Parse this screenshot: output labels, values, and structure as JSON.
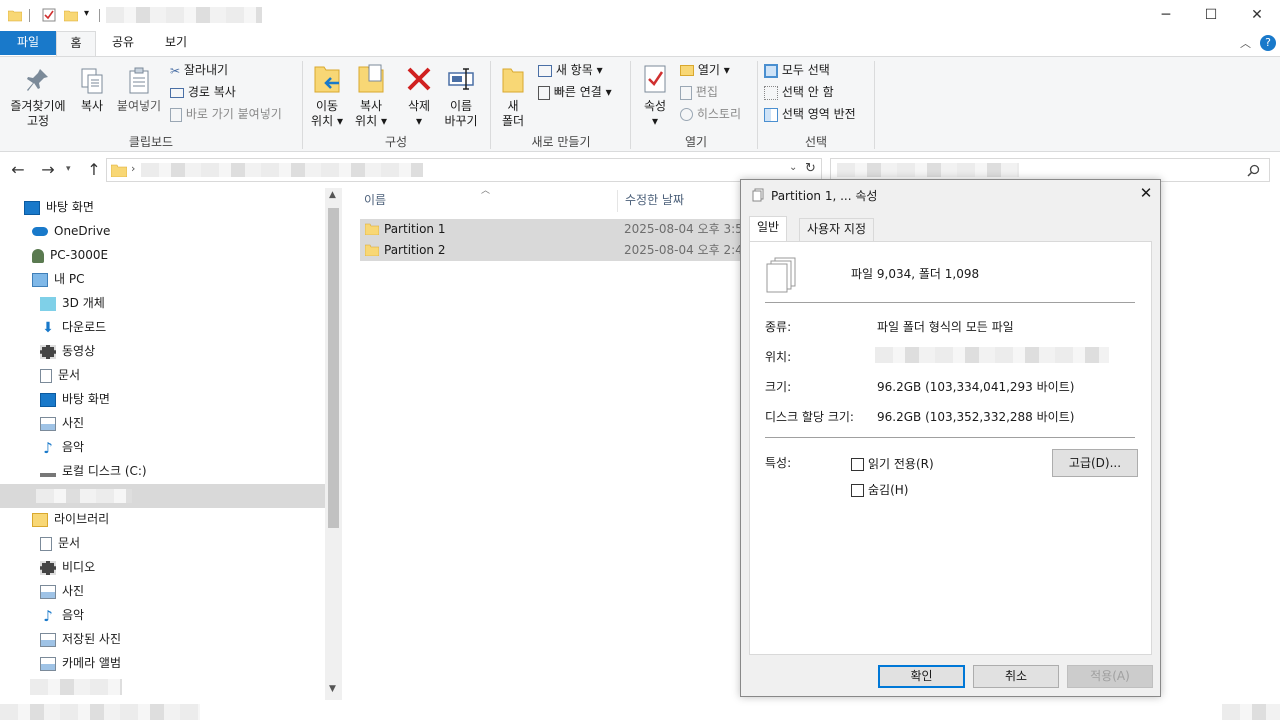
{
  "titlebar": {
    "minimize_label": "─",
    "maximize_label": "☐",
    "close_label": "✕",
    "customize_label": "▾"
  },
  "tabs": [
    {
      "label": "파일"
    },
    {
      "label": "홈"
    },
    {
      "label": "공유"
    },
    {
      "label": "보기"
    }
  ],
  "ribbon": {
    "clipboard": {
      "pin_label_1": "즐겨찾기에",
      "pin_label_2": "고정",
      "copy_label": "복사",
      "paste_label": "붙여넣기",
      "cut_label": "잘라내기",
      "copy_path_label": "경로 복사",
      "paste_shortcut_label": "바로 가기 붙여넣기",
      "group_label": "클립보드"
    },
    "organize": {
      "move_label_1": "이동",
      "move_label_2": "위치",
      "copyto_label_1": "복사",
      "copyto_label_2": "위치",
      "delete_label": "삭제",
      "rename_label_1": "이름",
      "rename_label_2": "바꾸기",
      "group_label": "구성"
    },
    "new": {
      "newfolder_label_1": "새",
      "newfolder_label_2": "폴더",
      "newitem_label": "새 항목",
      "easyaccess_label": "빠른 연결",
      "group_label": "새로 만들기"
    },
    "open": {
      "properties_label": "속성",
      "open_label": "열기",
      "edit_label": "편집",
      "history_label": "히스토리",
      "group_label": "열기"
    },
    "select": {
      "selectall_label": "모두 선택",
      "selectnone_label": "선택 안 함",
      "invert_label": "선택 영역 반전",
      "group_label": "선택"
    }
  },
  "nav": {
    "items": [
      {
        "label": "바탕 화면",
        "icon": "desktop-icon"
      },
      {
        "label": "OneDrive",
        "icon": "cloud-icon"
      },
      {
        "label": "PC-3000E",
        "icon": "user-icon"
      },
      {
        "label": "내 PC",
        "icon": "computer-icon"
      },
      {
        "label": "3D 개체",
        "icon": "cube-icon"
      },
      {
        "label": "다운로드",
        "icon": "download-icon"
      },
      {
        "label": "동영상",
        "icon": "film-icon"
      },
      {
        "label": "문서",
        "icon": "document-icon"
      },
      {
        "label": "바탕 화면",
        "icon": "desktop-icon"
      },
      {
        "label": "사진",
        "icon": "picture-icon"
      },
      {
        "label": "음악",
        "icon": "music-icon"
      },
      {
        "label": "로컬 디스크 (C:)",
        "icon": "drive-icon"
      },
      {
        "label": "",
        "icon": "blurred"
      },
      {
        "label": "라이브러리",
        "icon": "library-icon"
      },
      {
        "label": "문서",
        "icon": "document-icon"
      },
      {
        "label": "비디오",
        "icon": "film-icon"
      },
      {
        "label": "사진",
        "icon": "picture-icon"
      },
      {
        "label": "음악",
        "icon": "music-icon"
      },
      {
        "label": "저장된 사진",
        "icon": "picture-icon"
      },
      {
        "label": "카메라 앨범",
        "icon": "picture-icon"
      }
    ]
  },
  "filelist": {
    "col_name": "이름",
    "col_date": "수정한 날짜",
    "rows": [
      {
        "name": "Partition 1",
        "date": "2025-08-04 오후 3:5"
      },
      {
        "name": "Partition 2",
        "date": "2025-08-04 오후 2:4"
      }
    ]
  },
  "dialog": {
    "title": "Partition 1, ... 속성",
    "close_label": "✕",
    "tab_general": "일반",
    "tab_custom": "사용자 지정",
    "summary": "파일 9,034, 폴더 1,098",
    "type_label": "종류:",
    "type_value": "파일 폴더 형식의 모든 파일",
    "location_label": "위치:",
    "size_label": "크기:",
    "size_value": "96.2GB (103,334,041,293 바이트)",
    "ondisk_label": "디스크 할당 크기:",
    "ondisk_value": "96.2GB (103,352,332,288 바이트)",
    "attr_label": "특성:",
    "readonly_label": "읽기 전용(R)",
    "hidden_label": "숨김(H)",
    "advanced_label": "고급(D)...",
    "ok_label": "확인",
    "cancel_label": "취소",
    "apply_label": "적용(A)"
  },
  "colors": {
    "accent": "#1979ca",
    "folder": "#f8d775",
    "selection": "#d9d9d9"
  }
}
